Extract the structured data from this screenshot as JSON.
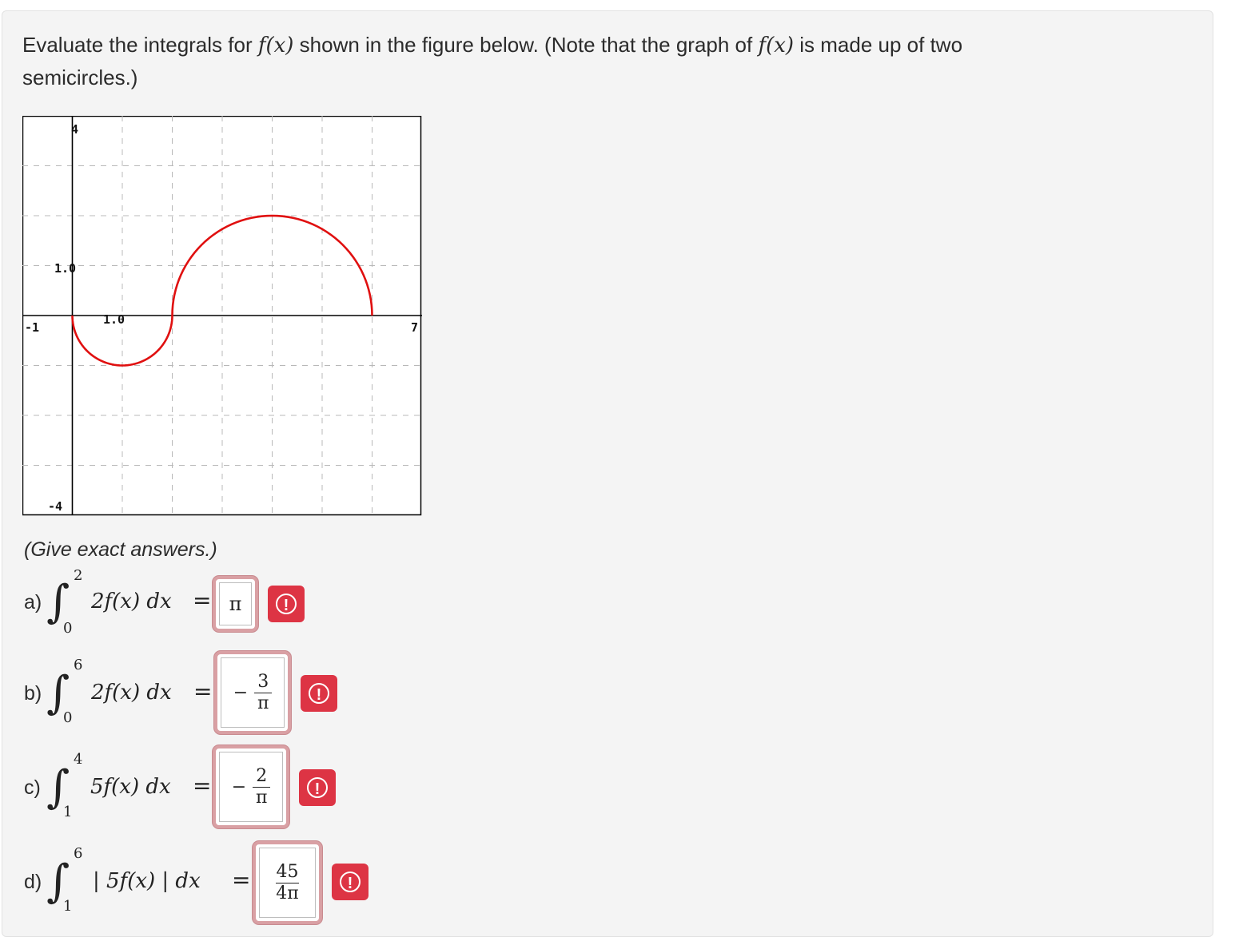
{
  "prompt": {
    "line1_a": "Evaluate the integrals for ",
    "fx": "f(x)",
    "line1_b": " shown in the figure below. (Note that the graph of ",
    "line1_c": " is made up of two",
    "line2": "semicircles.)"
  },
  "graph": {
    "tick_labels": {
      "y_top": "4",
      "y_bottom": "-4",
      "y_one": "1.0",
      "x_left": "-1",
      "x_one": "1.0",
      "x_right": "7"
    },
    "curve_color": "#e01010"
  },
  "chart_data": {
    "type": "line",
    "xlim": [
      -1,
      7
    ],
    "ylim": [
      -4,
      4
    ],
    "grid": true,
    "series": [
      {
        "x": [
          0,
          0.25,
          0.5,
          1,
          1.5,
          1.75,
          2,
          2.25,
          2.5,
          3,
          4,
          5,
          5.5,
          5.75,
          6
        ],
        "y": [
          0,
          -0.66,
          -0.87,
          -1,
          -0.87,
          -0.66,
          0,
          1.0,
          1.32,
          1.73,
          2,
          1.73,
          1.32,
          1.0,
          0
        ]
      }
    ]
  },
  "instructions": "(Give exact answers.)",
  "questions": [
    {
      "label": "a)",
      "upper": "2",
      "lower": "0",
      "expr": "2f(x) dx",
      "answer_num": "π",
      "answer_den": "",
      "negative": false
    },
    {
      "label": "b)",
      "upper": "6",
      "lower": "0",
      "expr": "2f(x) dx",
      "answer_num": "3",
      "answer_den": "π",
      "negative": true
    },
    {
      "label": "c)",
      "upper": "4",
      "lower": "1",
      "expr": "5f(x) dx",
      "answer_num": "2",
      "answer_den": "π",
      "negative": true
    },
    {
      "label": "d)",
      "upper": "6",
      "lower": "1",
      "expr": "| 5f(x) |  dx",
      "answer_num": "45",
      "answer_den": "4π",
      "negative": false
    }
  ],
  "status_icon": "warning-exclamation-icon",
  "status_color": "#dd3444"
}
